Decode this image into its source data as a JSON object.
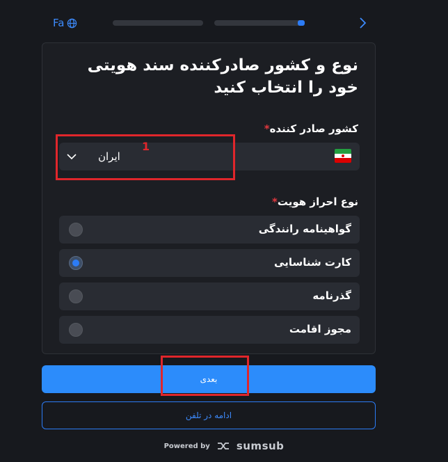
{
  "header": {
    "language_label": "Fa",
    "language_icon": "globe-icon",
    "next_icon": "chevron-right-icon",
    "steps": [
      {
        "progress": 0
      },
      {
        "progress": 0.08
      }
    ]
  },
  "card": {
    "title": "نوع و کشور صادرکننده سند هویتی خود را انتخاب کنید",
    "country_label": "کشور صادر کننده",
    "required_mark": "*",
    "country_value": "ایران",
    "country_flag_icon": "iran-flag-icon",
    "doc_type_label": "نوع احراز هویت",
    "doc_types": [
      {
        "label": "گواهینامه رانندگی",
        "selected": false
      },
      {
        "label": "کارت شناسایی",
        "selected": true
      },
      {
        "label": "گذرنامه",
        "selected": false
      },
      {
        "label": "مجوز اقامت",
        "selected": false
      }
    ]
  },
  "actions": {
    "next_label": "بعدی",
    "continue_phone_label": "ادامه در تلفن"
  },
  "annotations": [
    {
      "number": "1"
    }
  ],
  "footer": {
    "powered_by": "Powered by",
    "brand": "sumsub"
  },
  "colors": {
    "background": "#17191e",
    "card": "#1c1e23",
    "accent": "#2c8cfb",
    "annotation": "#e0262b",
    "required": "#e0383e"
  }
}
